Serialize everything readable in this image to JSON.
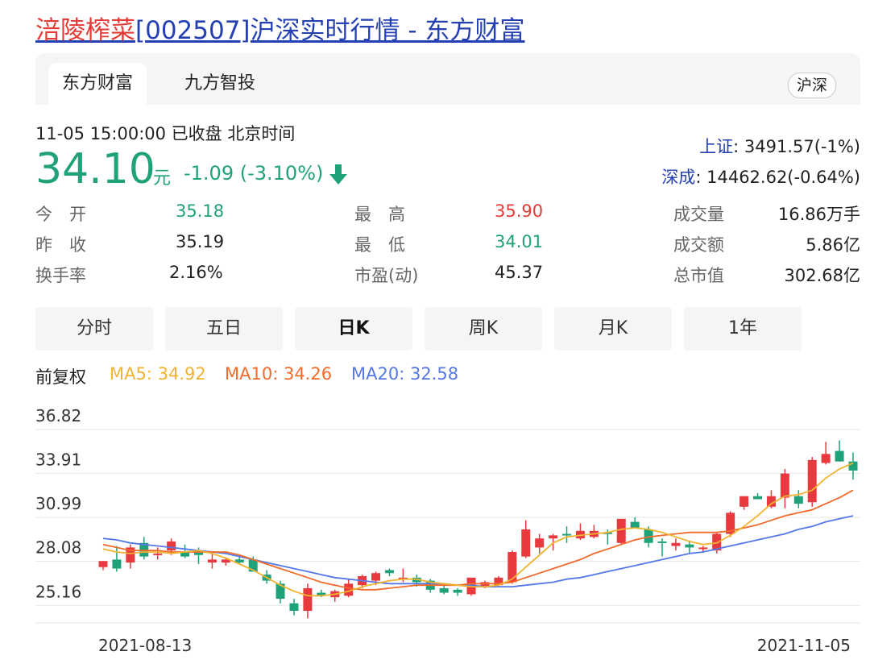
{
  "header": {
    "title_highlight": "涪陵榨菜",
    "title_rest": "[002507]沪深实时行情 - 东方财富"
  },
  "source_tabs": [
    {
      "label": "东方财富",
      "active": true
    },
    {
      "label": "九方智投",
      "active": false
    }
  ],
  "market_button": "沪深",
  "quote": {
    "timestamp": "11-05 15:00:00  已收盘  北京时间",
    "price": "34.10",
    "unit": "元",
    "change": "-1.09 (-3.10%)",
    "direction": "down"
  },
  "indices": [
    {
      "name": "上证",
      "value": ": 3491.57(-1%)"
    },
    {
      "name": "深成",
      "value": ": 14462.62(-0.64%)"
    }
  ],
  "stats": [
    {
      "label": "今　开",
      "value": "35.18",
      "color": "#1fa27a"
    },
    {
      "label": "最　高",
      "value": "35.90",
      "color": "#e43b37"
    },
    {
      "label": "成交量",
      "value": "16.86万手",
      "color": "#222222"
    },
    {
      "label": "昨　收",
      "value": "35.19",
      "color": "#222222"
    },
    {
      "label": "最　低",
      "value": "34.01",
      "color": "#1fa27a"
    },
    {
      "label": "成交额",
      "value": "5.86亿",
      "color": "#222222"
    },
    {
      "label": "换手率",
      "value": "2.16%",
      "color": "#222222"
    },
    {
      "label": "市盈(动)",
      "value": "45.37",
      "color": "#222222"
    },
    {
      "label": "总市值",
      "value": "302.68亿",
      "color": "#222222"
    }
  ],
  "period_tabs": [
    {
      "label": "分时",
      "active": false
    },
    {
      "label": "五日",
      "active": false
    },
    {
      "label": "日K",
      "active": true
    },
    {
      "label": "周K",
      "active": false
    },
    {
      "label": "月K",
      "active": false
    },
    {
      "label": "1年",
      "active": false
    }
  ],
  "legend": {
    "adjust": "前复权",
    "ma5": "MA5: 34.92",
    "ma10": "MA10: 34.26",
    "ma20": "MA20: 32.58"
  },
  "colors": {
    "up": "#e8393f",
    "down": "#1fa27a",
    "ma5": "#f2b330",
    "ma10": "#f26b2a",
    "ma20": "#5478e8",
    "title_link": "#2440b3"
  },
  "chart_data": {
    "type": "candlestick",
    "y_ticks": [
      "36.82",
      "33.91",
      "30.99",
      "28.08",
      "25.16"
    ],
    "ylim": [
      24.0,
      36.82
    ],
    "x_labels": [
      "2021-08-13",
      "2021-11-05"
    ],
    "candles": [
      [
        27.7,
        28.1,
        27.5,
        28.1
      ],
      [
        28.2,
        29.1,
        27.4,
        27.6
      ],
      [
        28.0,
        29.2,
        27.6,
        29.0
      ],
      [
        29.3,
        29.7,
        28.2,
        28.4
      ],
      [
        28.6,
        29.0,
        28.2,
        28.6
      ],
      [
        28.8,
        29.6,
        28.5,
        29.4
      ],
      [
        28.7,
        29.2,
        28.3,
        28.4
      ],
      [
        28.8,
        29.0,
        27.9,
        28.5
      ],
      [
        28.0,
        28.6,
        27.6,
        28.2
      ],
      [
        28.0,
        28.3,
        27.8,
        28.2
      ],
      [
        28.2,
        28.4,
        27.9,
        28.0
      ],
      [
        28.2,
        28.4,
        27.8,
        27.4
      ],
      [
        27.2,
        27.5,
        26.6,
        26.8
      ],
      [
        26.6,
        26.8,
        25.3,
        25.6
      ],
      [
        25.3,
        25.6,
        24.5,
        24.8
      ],
      [
        24.8,
        26.6,
        24.3,
        26.3
      ],
      [
        26.0,
        26.2,
        25.7,
        25.8
      ],
      [
        25.7,
        26.2,
        25.4,
        26.1
      ],
      [
        25.8,
        26.9,
        25.7,
        26.6
      ],
      [
        26.5,
        27.2,
        26.3,
        27.1
      ],
      [
        26.8,
        27.4,
        26.5,
        27.3
      ],
      [
        27.5,
        27.6,
        27.1,
        27.3
      ],
      [
        26.9,
        27.6,
        26.7,
        27.0
      ],
      [
        27.0,
        27.2,
        26.4,
        26.7
      ],
      [
        26.8,
        26.9,
        26.0,
        26.2
      ],
      [
        26.3,
        26.5,
        25.9,
        26.0
      ],
      [
        26.2,
        26.3,
        25.8,
        26.0
      ],
      [
        25.9,
        27.0,
        25.8,
        27.0
      ],
      [
        26.4,
        26.8,
        26.3,
        26.7
      ],
      [
        26.5,
        27.1,
        26.4,
        27.0
      ],
      [
        26.7,
        28.8,
        26.6,
        28.7
      ],
      [
        28.4,
        30.8,
        28.3,
        30.2
      ],
      [
        29.0,
        29.9,
        28.6,
        29.6
      ],
      [
        29.6,
        29.9,
        28.8,
        29.8
      ],
      [
        29.9,
        30.4,
        29.3,
        29.8
      ],
      [
        29.6,
        30.6,
        29.5,
        30.1
      ],
      [
        29.7,
        30.5,
        29.6,
        30.1
      ],
      [
        30.0,
        30.2,
        29.2,
        29.9
      ],
      [
        29.3,
        30.8,
        29.2,
        30.9
      ],
      [
        30.7,
        31.0,
        30.4,
        30.3
      ],
      [
        30.2,
        30.4,
        29.0,
        29.3
      ],
      [
        29.4,
        29.6,
        28.4,
        29.3
      ],
      [
        29.1,
        29.6,
        28.8,
        29.3
      ],
      [
        29.2,
        29.4,
        28.6,
        29.0
      ],
      [
        28.9,
        29.1,
        28.7,
        29.0
      ],
      [
        28.8,
        30.0,
        28.6,
        29.9
      ],
      [
        29.9,
        31.4,
        29.7,
        31.3
      ],
      [
        31.7,
        32.4,
        31.5,
        32.4
      ],
      [
        32.4,
        32.6,
        32.2,
        32.2
      ],
      [
        31.7,
        32.8,
        31.6,
        32.4
      ],
      [
        32.3,
        34.2,
        31.6,
        33.9
      ],
      [
        32.4,
        32.8,
        31.6,
        31.9
      ],
      [
        32.0,
        35.0,
        31.7,
        34.8
      ],
      [
        34.6,
        36.0,
        34.5,
        35.2
      ],
      [
        35.4,
        36.1,
        34.7,
        34.7
      ],
      [
        34.7,
        35.3,
        33.5,
        34.1
      ]
    ],
    "ma5": [
      28.9,
      28.7,
      28.6,
      28.7,
      28.7,
      28.6,
      28.7,
      28.8,
      28.6,
      28.3,
      27.9,
      27.5,
      27.0,
      26.5,
      26.1,
      25.8,
      25.8,
      25.9,
      26.1,
      26.4,
      26.6,
      26.8,
      26.9,
      26.9,
      26.7,
      26.6,
      26.5,
      26.4,
      26.4,
      26.5,
      26.9,
      27.7,
      28.5,
      29.3,
      29.7,
      29.8,
      29.9,
      30.0,
      30.2,
      30.3,
      30.2,
      30.0,
      29.7,
      29.4,
      29.2,
      29.3,
      29.8,
      30.4,
      31.1,
      31.9,
      32.4,
      32.5,
      32.8,
      33.6,
      34.2,
      34.6
    ],
    "ma10": [
      29.2,
      29.0,
      28.8,
      28.8,
      28.8,
      28.7,
      28.7,
      28.7,
      28.7,
      28.7,
      28.5,
      28.2,
      27.9,
      27.6,
      27.3,
      27.0,
      26.7,
      26.5,
      26.3,
      26.2,
      26.2,
      26.3,
      26.4,
      26.5,
      26.5,
      26.5,
      26.5,
      26.6,
      26.6,
      26.6,
      26.7,
      27.0,
      27.3,
      27.6,
      27.9,
      28.2,
      28.6,
      28.9,
      29.2,
      29.5,
      29.7,
      29.8,
      29.9,
      30.0,
      30.0,
      30.0,
      30.1,
      30.3,
      30.5,
      30.8,
      31.1,
      31.3,
      31.5,
      31.9,
      32.3,
      32.8
    ],
    "ma20": [
      29.6,
      29.5,
      29.3,
      29.2,
      29.1,
      29.0,
      28.9,
      28.8,
      28.7,
      28.6,
      28.4,
      28.2,
      28.0,
      27.8,
      27.6,
      27.4,
      27.2,
      27.0,
      26.9,
      26.8,
      26.7,
      26.6,
      26.6,
      26.6,
      26.6,
      26.6,
      26.5,
      26.5,
      26.4,
      26.4,
      26.4,
      26.5,
      26.6,
      26.7,
      26.9,
      27.0,
      27.2,
      27.4,
      27.6,
      27.8,
      28.0,
      28.2,
      28.4,
      28.6,
      28.7,
      28.9,
      29.1,
      29.3,
      29.5,
      29.7,
      29.9,
      30.2,
      30.4,
      30.7,
      30.9,
      31.1
    ]
  }
}
